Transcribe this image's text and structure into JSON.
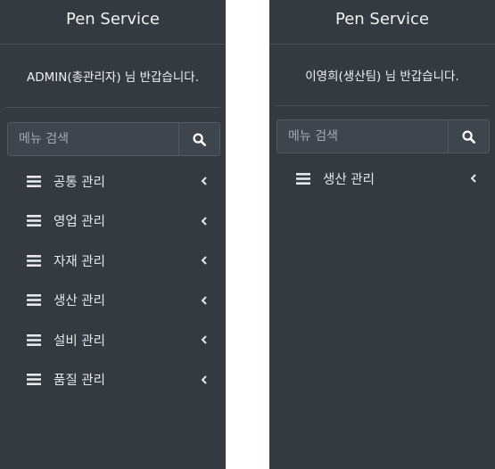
{
  "left": {
    "brand": "Pen Service",
    "welcome": "ADMIN(총관리자) 님 반갑습니다.",
    "search": {
      "placeholder": "메뉴 검색"
    },
    "menu": [
      {
        "label": "공통 관리"
      },
      {
        "label": "영업 관리"
      },
      {
        "label": "자재 관리"
      },
      {
        "label": "생산 관리"
      },
      {
        "label": "설비 관리"
      },
      {
        "label": "품질 관리"
      }
    ]
  },
  "right": {
    "brand": "Pen Service",
    "welcome": "이영희(생산팀) 님 반갑습니다.",
    "search": {
      "placeholder": "메뉴 검색"
    },
    "menu": [
      {
        "label": "생산 관리"
      }
    ]
  },
  "icons": {
    "search": "search-icon",
    "menu": "bars-icon",
    "expand": "chevron-left-icon"
  },
  "colors": {
    "sidebar_bg": "#353a40",
    "text": "#e6e8ea",
    "divider": "#4a5057"
  }
}
